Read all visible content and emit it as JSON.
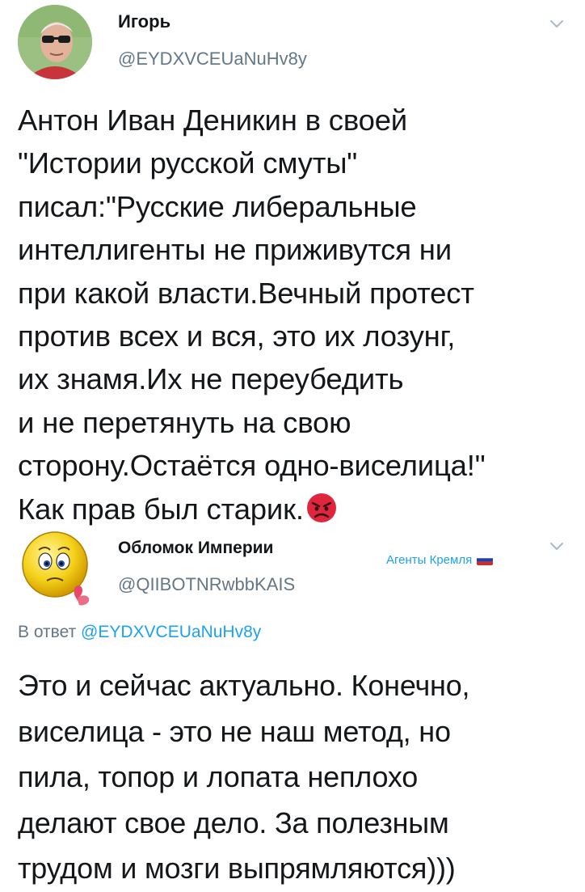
{
  "tweets": [
    {
      "display_name": "Игорь",
      "handle": "@EYDXVCEUaNuHv8y",
      "text": "Антон Иван Деникин в своей\n\"Истории русской смуты\"\nписал:\"Русские либеральные\nинтеллигенты не приживутся ни\nпри какой власти.Вечный протест\nпротив всех и вся, это их лозунг,\nих знамя.Их не переубедить\nи не перетянуть на свою\nсторону.Остаётся одно-виселица!\"\nКак прав был старик.",
      "emoji": "angry-face-emoji"
    },
    {
      "display_name": "Обломок Империи",
      "handle": "@QIIBOTNRwbbKAIS",
      "badge_text": "Агенты Кремля",
      "badge_flag": "russian-flag-icon",
      "reply_prefix": "В ответ",
      "reply_handle": "@EYDXVCEUaNuHv8y",
      "text": "Это и сейчас актуально. Конечно,\nвиселица - это не наш метод, но\nпила, топор и лопата неплохо\nделают свое дело. За полезным\nтрудом и мозги выпрямляются)))"
    }
  ],
  "colors": {
    "link": "#1da1f2",
    "secondary": "#657786",
    "text": "#14171a"
  }
}
